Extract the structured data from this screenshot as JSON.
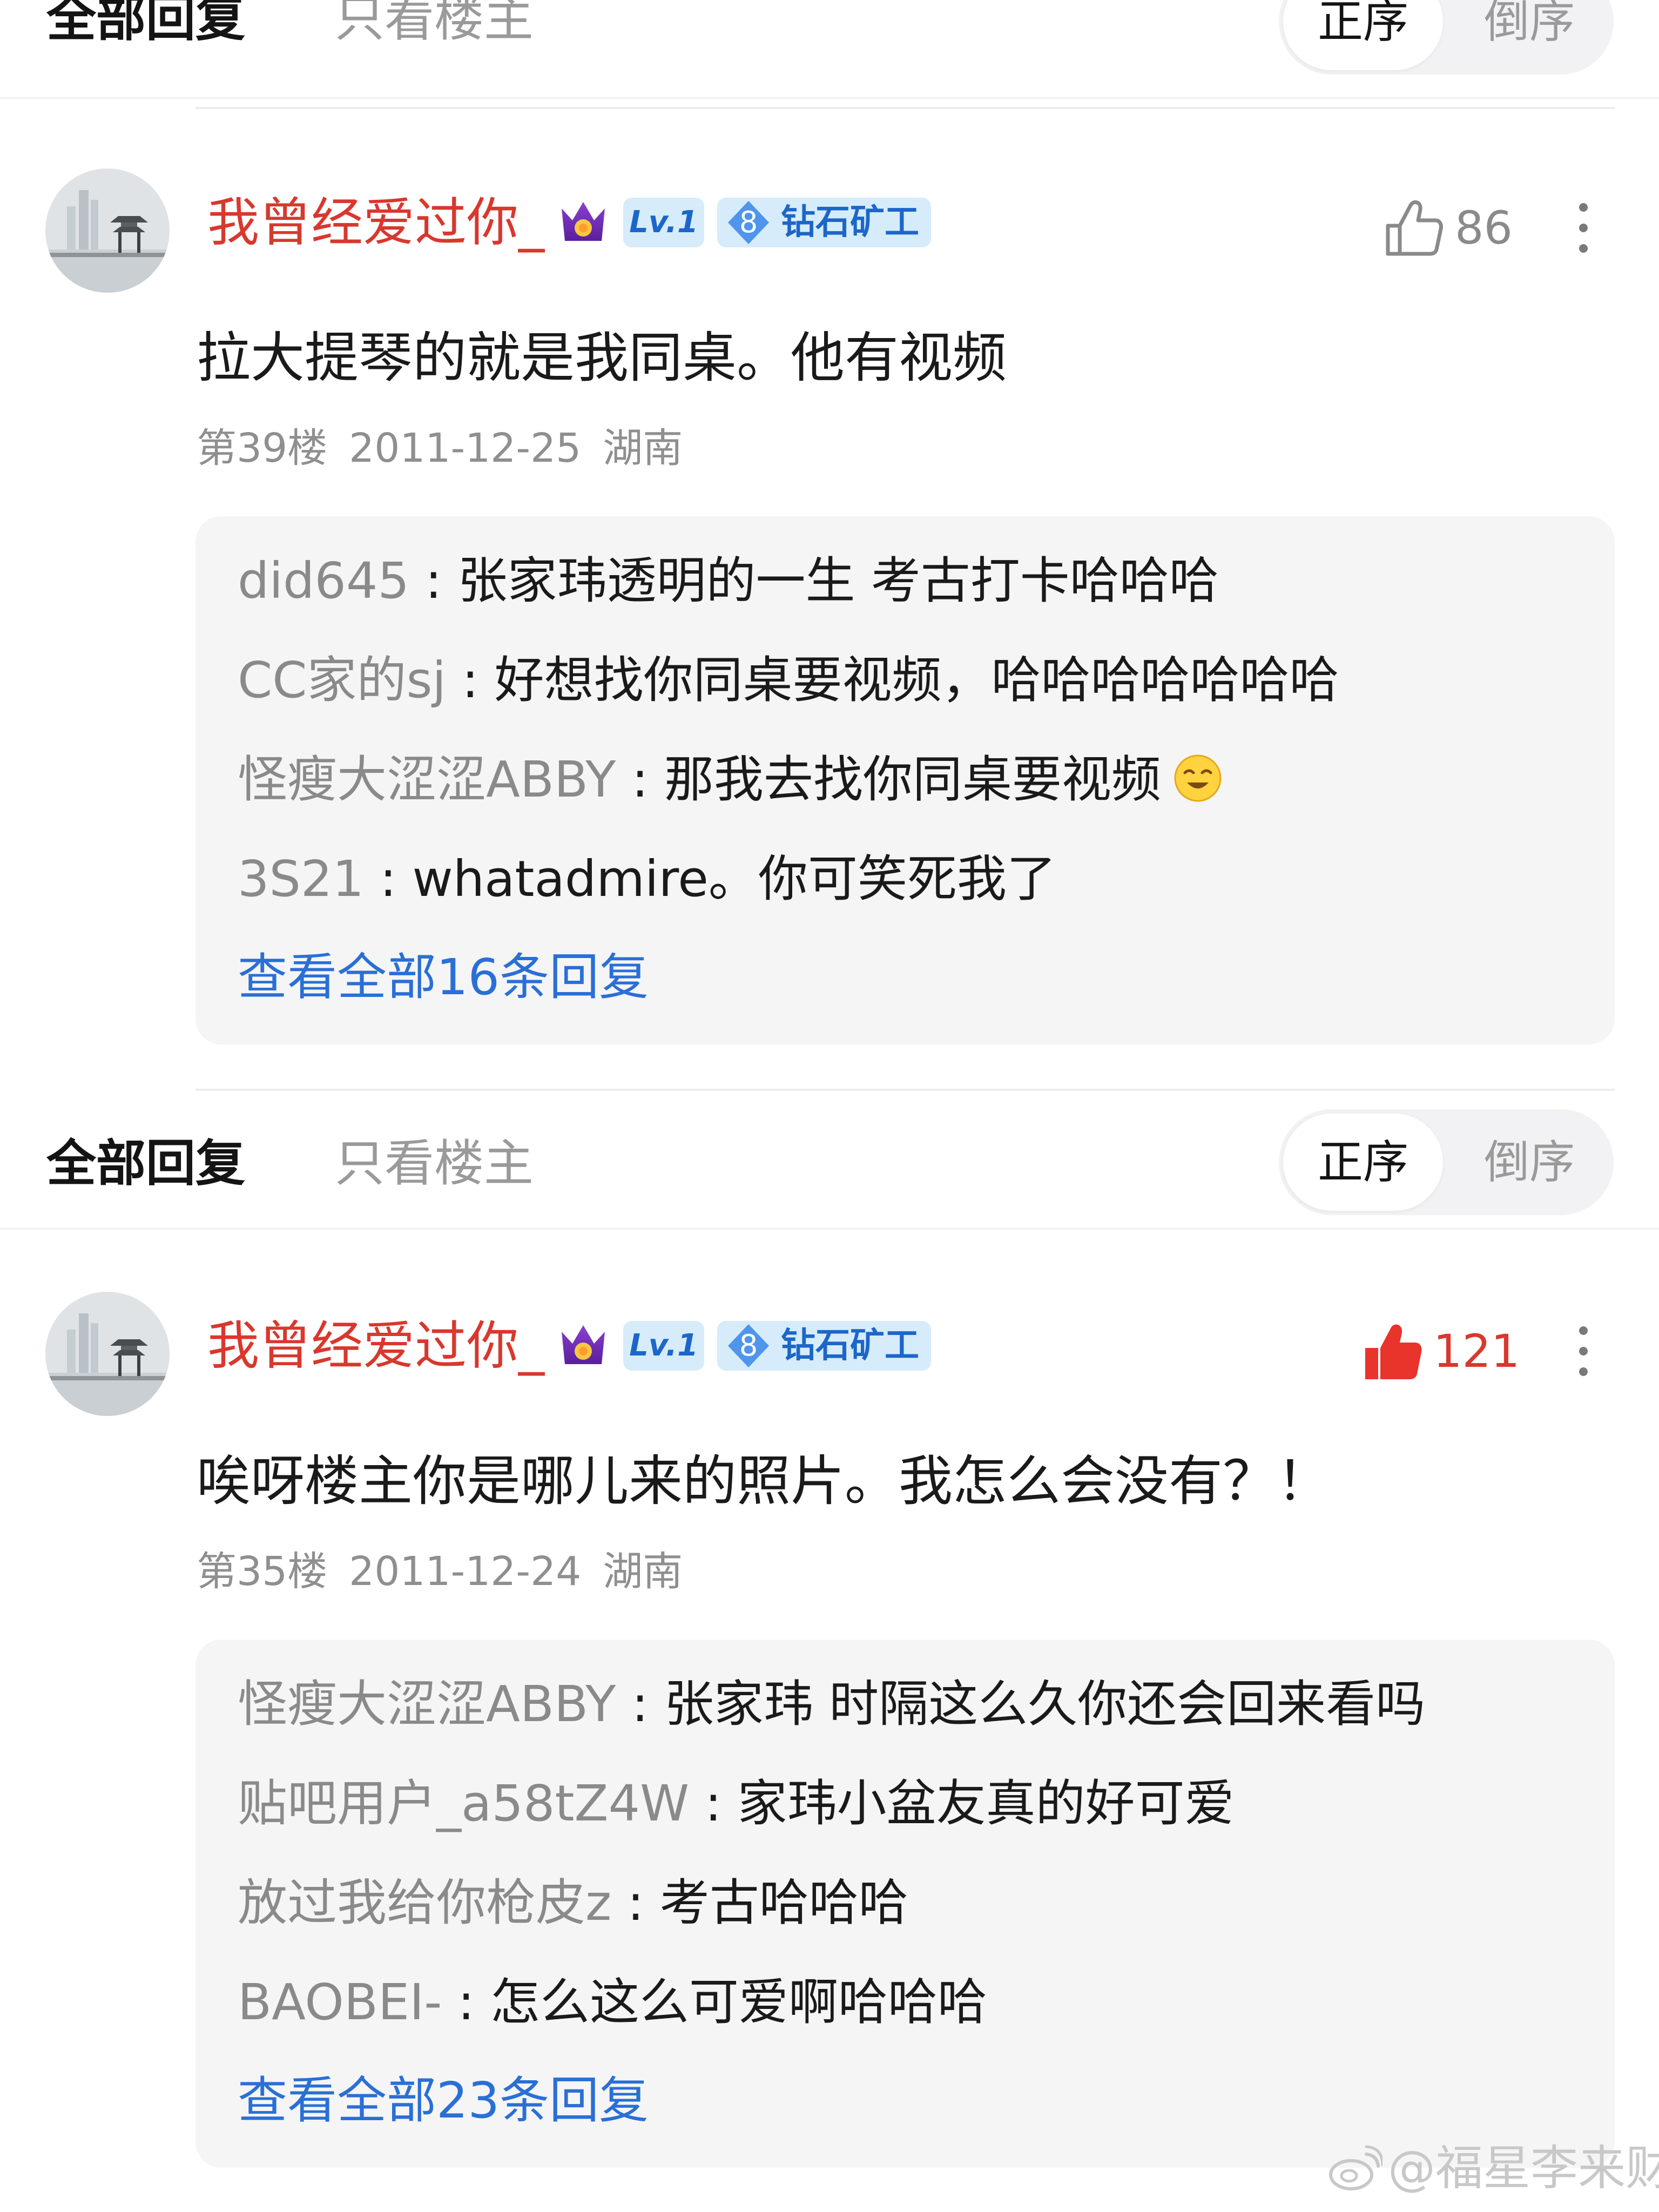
{
  "filter_bar": {
    "all_replies_label": "全部回复",
    "op_only_label": "只看楼主",
    "sort_asc_label": "正序",
    "sort_desc_label": "倒序"
  },
  "comments": [
    {
      "username": "我曾经爱过你_",
      "level_badge": "Lv.1",
      "title_badge_level": "8",
      "title_badge_text": "钻石矿工",
      "like_count": "86",
      "liked": false,
      "text": "拉大提琴的就是我同桌。他有视频",
      "floor": "第39楼",
      "date": "2011-12-25",
      "location": "湖南",
      "replies": [
        {
          "name": "did645",
          "text": "张家玮透明的一生 考古打卡哈哈哈"
        },
        {
          "name": "CC家的sj",
          "text": "好想找你同桌要视频，哈哈哈哈哈哈哈"
        },
        {
          "name": "怪瘦大涩涩ABBY",
          "text": "那我去找你同桌要视频"
        },
        {
          "name": "3S21",
          "text": "whatadmire。你可笑死我了"
        }
      ],
      "view_all": "查看全部16条回复"
    },
    {
      "username": "我曾经爱过你_",
      "level_badge": "Lv.1",
      "title_badge_level": "8",
      "title_badge_text": "钻石矿工",
      "like_count": "121",
      "liked": true,
      "text": "唉呀楼主你是哪儿来的照片。我怎么会没有？！",
      "floor": "第35楼",
      "date": "2011-12-24",
      "location": "湖南",
      "replies": [
        {
          "name": "怪瘦大涩涩ABBY",
          "text": "张家玮 时隔这么久你还会回来看吗"
        },
        {
          "name": "贴吧用户_a58tZ4W",
          "text": "家玮小盆友真的好可爱"
        },
        {
          "name": "放过我给你枪皮z",
          "text": "考古哈哈哈"
        },
        {
          "name": "BAOBEI-",
          "text": "怎么这么可爱啊哈哈哈"
        }
      ],
      "view_all": "查看全部23条回复"
    }
  ],
  "reply_separator": " : ",
  "watermark": "@福星李来财",
  "colors": {
    "username": "#d8382e",
    "link": "#2a6fd6",
    "badge_bg": "#d6ecfb",
    "badge_text": "#1d66c9",
    "like_active": "#d8382e"
  },
  "icons": [
    "crown-icon",
    "diamond-icon",
    "thumb-up-icon",
    "more-icon",
    "smile-emoji-icon",
    "weibo-icon"
  ]
}
